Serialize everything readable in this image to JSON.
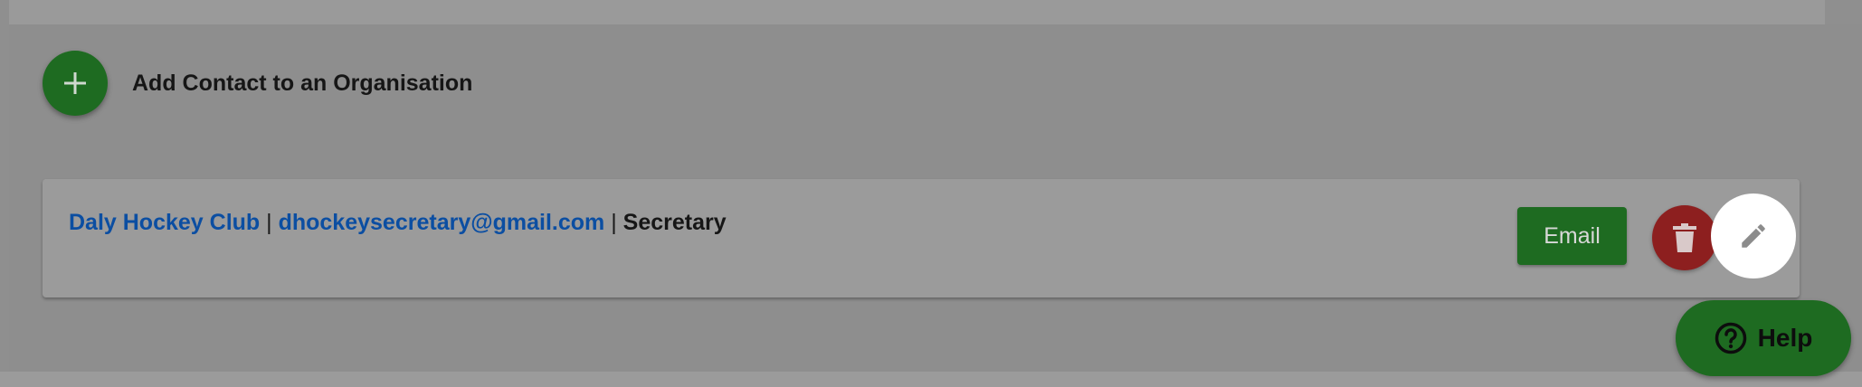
{
  "add_contact": {
    "label": "Add Contact to an Organisation"
  },
  "contact": {
    "organisation": "Daly Hockey Club",
    "separator": "|",
    "email": "dhockeysecretary@gmail.com",
    "role": "Secretary",
    "email_button_label": "Email"
  },
  "help": {
    "label": "Help"
  },
  "colors": {
    "primary_green": "#1e6b21",
    "danger_red": "#8d1f1f",
    "link_blue": "#0b4ea2"
  },
  "icons": {
    "add": "plus-icon",
    "delete": "trash-icon",
    "edit": "pencil-icon",
    "help": "question-circle-icon"
  }
}
